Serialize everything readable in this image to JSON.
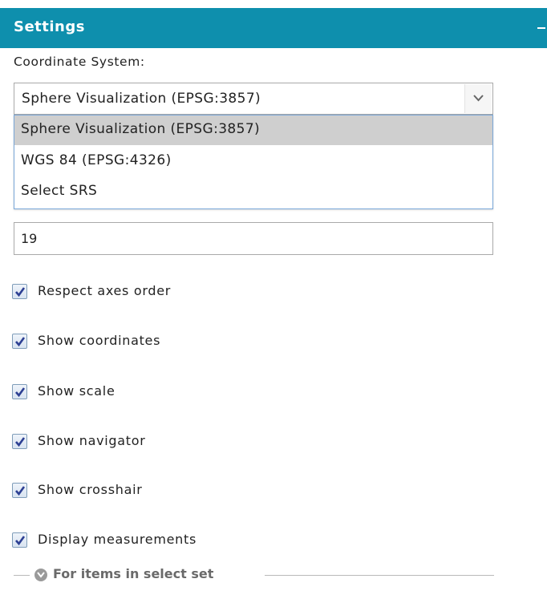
{
  "panel": {
    "title": "Settings",
    "collapse_icon": "minus-icon"
  },
  "coordinate_system": {
    "label": "Coordinate System:",
    "selected": "Sphere Visualization (EPSG:3857)",
    "options": [
      "Sphere Visualization (EPSG:3857)",
      "WGS 84 (EPSG:4326)",
      "Select SRS"
    ]
  },
  "screen_size": {
    "value": "19"
  },
  "checkboxes": [
    {
      "label": "Respect axes order",
      "checked": true
    },
    {
      "label": "Show coordinates",
      "checked": true
    },
    {
      "label": "Show scale",
      "checked": true
    },
    {
      "label": "Show navigator",
      "checked": true
    },
    {
      "label": "Show crosshair",
      "checked": true
    },
    {
      "label": "Display measurements",
      "checked": true
    }
  ],
  "select_set": {
    "label": "For items in select set",
    "icon": "chevron-down-circle-icon"
  },
  "colors": {
    "header": "#0e8fad",
    "dropdown_selected": "#cfcfcf",
    "checkmark": "#2c3f93"
  }
}
